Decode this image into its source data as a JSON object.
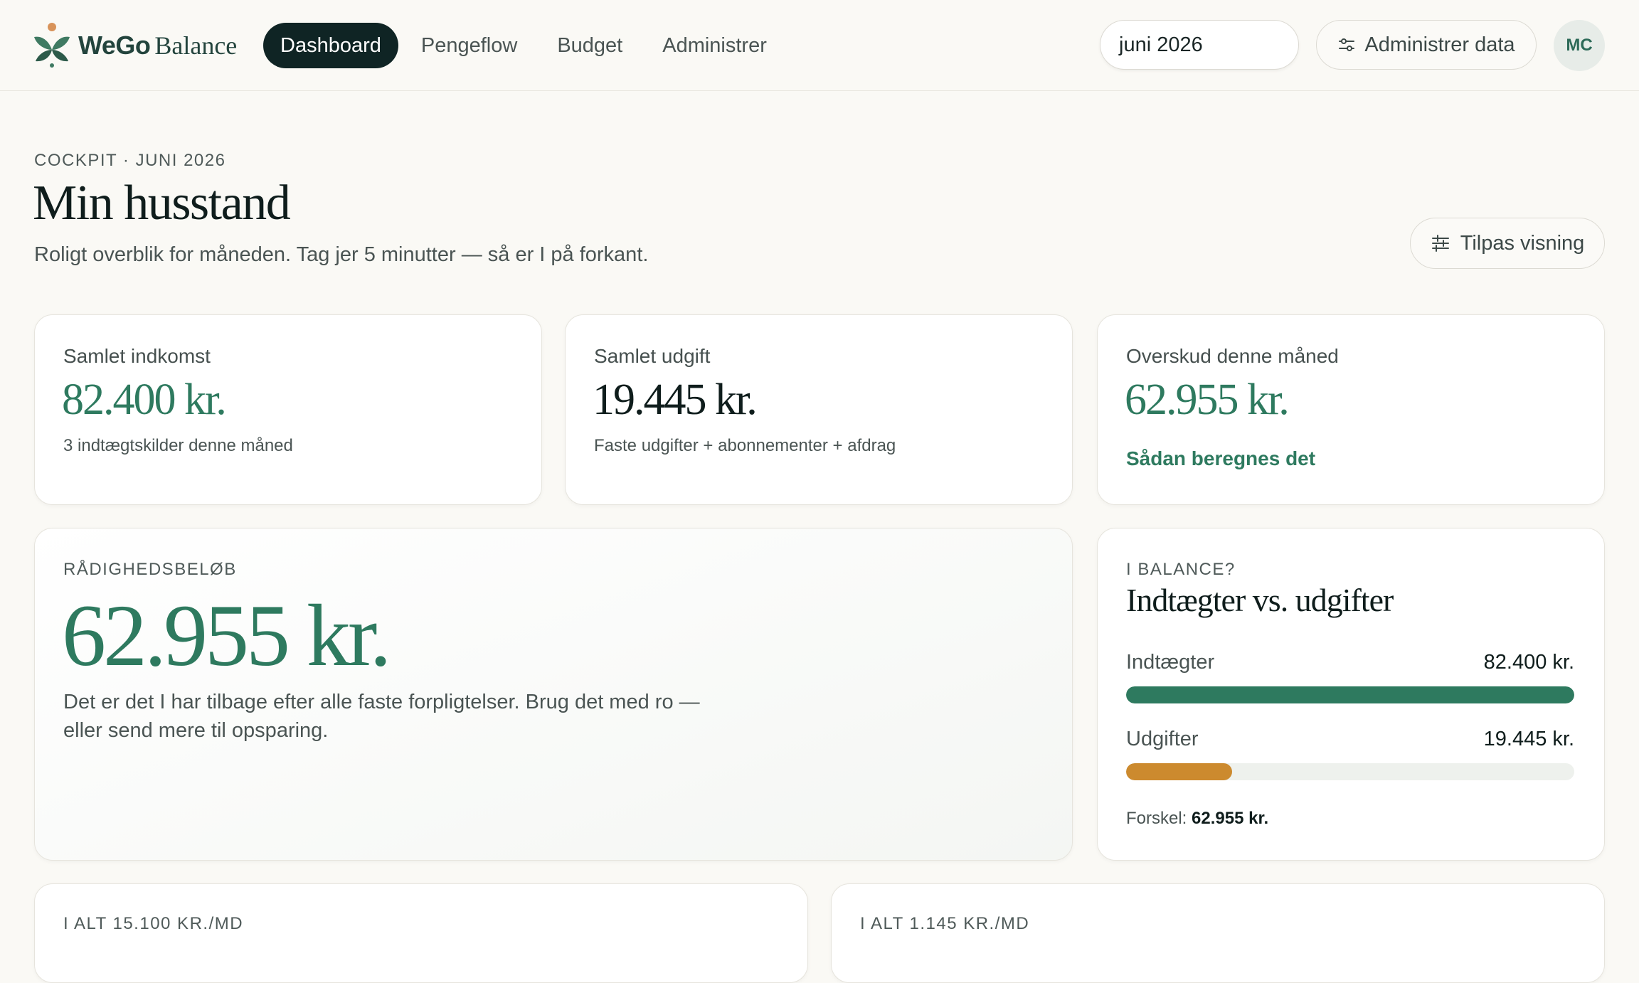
{
  "brand": {
    "name_bold": "WeGo",
    "name_light": "Balance"
  },
  "nav": [
    {
      "label": "Dashboard"
    },
    {
      "label": "Pengeflow"
    },
    {
      "label": "Budget"
    },
    {
      "label": "Administrer"
    }
  ],
  "header": {
    "month_value": "juni  2026",
    "manage_label": "Administrer data",
    "avatar_initials": "MC"
  },
  "page": {
    "eyebrow": "COCKPIT · JUNI 2026",
    "title": "Min husstand",
    "subtitle": "Roligt overblik for måneden. Tag jer 5 minutter — så er I på forkant.",
    "customize_label": "Tilpas visning"
  },
  "stats": {
    "income": {
      "label": "Samlet indkomst",
      "value": "82.400 kr.",
      "note": "3 indtægtskilder denne måned"
    },
    "expense": {
      "label": "Samlet udgift",
      "value": "19.445 kr.",
      "note": "Faste udgifter + abonnementer + afdrag"
    },
    "surplus": {
      "label": "Overskud denne måned",
      "value": "62.955 kr.",
      "link": "Sådan beregnes det"
    }
  },
  "available": {
    "eyebrow": "RÅDIGHEDSBELØB",
    "value": "62.955 kr.",
    "description": "Det er det I har tilbage efter alle faste forpligtelser. Brug det med ro — eller send mere til opsparing."
  },
  "balance": {
    "eyebrow": "I BALANCE?",
    "title": "Indtægter vs. udgifter",
    "income_label": "Indtægter",
    "income_amount": "82.400 kr.",
    "income_fraction": 1.0,
    "expense_label": "Udgifter",
    "expense_amount": "19.445 kr.",
    "expense_fraction": 0.236,
    "diff_label": "Forskel:",
    "diff_value": "62.955 kr.",
    "colors": {
      "income": "#2e7a5f",
      "expense": "#cc8a2e"
    }
  },
  "bottom": {
    "left_eyebrow": "I ALT 15.100 KR./MD",
    "right_eyebrow": "I ALT 1.145 KR./MD"
  }
}
